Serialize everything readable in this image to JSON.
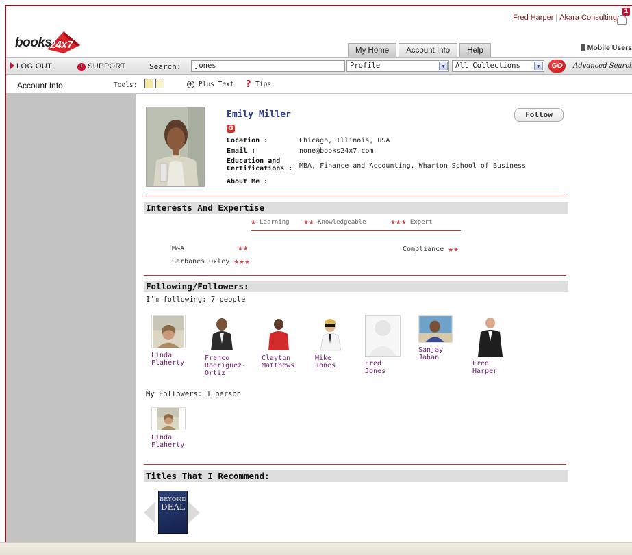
{
  "header": {
    "user_name": "Fred Harper",
    "organization": "Akara Consulting",
    "separator": "|",
    "notification_count": "1",
    "logo_text": "books",
    "logo_badge": "24x7",
    "mobile_users": "Mobile Users"
  },
  "nav_tabs": [
    {
      "label": "My Home"
    },
    {
      "label": "Account Info"
    },
    {
      "label": "Help"
    }
  ],
  "toolbar": {
    "logout": "LOG OUT",
    "support": "SUPPORT",
    "search_label": "Search:",
    "search_value": "jones",
    "search_type": "Profile",
    "collection": "All Collections",
    "go": "GO",
    "advanced_search": "Advanced Search"
  },
  "section_bar": {
    "title": "Account Info",
    "tools_label": "Tools:",
    "plus_text": "Plus Text",
    "tips": "Tips"
  },
  "profile": {
    "name": "Emily Miller",
    "follow_label": "Follow",
    "fields": [
      {
        "label": "Location :",
        "value": "Chicago, Illinois, USA"
      },
      {
        "label": "Email :",
        "value": "none@books24x7.com"
      },
      {
        "label": "Education and Certifications :",
        "value": "MBA, Finance and Accounting, Wharton School of Business"
      },
      {
        "label": "About Me :",
        "value": ""
      }
    ]
  },
  "interests": {
    "heading": "Interests And Expertise",
    "legend": [
      {
        "label": "Learning",
        "stars": 1
      },
      {
        "label": "Knowledgeable",
        "stars": 2
      },
      {
        "label": "Expert",
        "stars": 3
      }
    ],
    "skills": [
      {
        "name": "M&A",
        "stars": 2
      },
      {
        "name": "Sarbanes Oxley",
        "stars": 3
      },
      {
        "name": "Compliance",
        "stars": 2
      }
    ]
  },
  "following": {
    "heading": "Following/Followers:",
    "following_label": "I'm following:",
    "following_count": "7 people",
    "people": [
      {
        "name": "Linda Flaherty",
        "line1": "Linda",
        "line2": "Flaherty",
        "line3": ""
      },
      {
        "name": "Franco Rodriguez-Ortiz",
        "line1": "Franco",
        "line2": "Rodriguez-",
        "line3": "Ortiz"
      },
      {
        "name": "Clayton Matthews",
        "line1": "Clayton",
        "line2": "Matthews",
        "line3": ""
      },
      {
        "name": "Mike Jones",
        "line1": "Mike",
        "line2": "Jones",
        "line3": ""
      },
      {
        "name": "Fred Jones",
        "line1": "Fred",
        "line2": "Jones",
        "line3": ""
      },
      {
        "name": "Sanjay Jahan",
        "line1": "Sanjay",
        "line2": "Jahan",
        "line3": ""
      },
      {
        "name": "Fred Harper",
        "line1": "Fred",
        "line2": "Harper",
        "line3": ""
      }
    ],
    "followers_label": "My Followers:",
    "followers_count": "1 person",
    "followers": [
      {
        "name": "Linda Flaherty",
        "line1": "Linda",
        "line2": "Flaherty"
      }
    ]
  },
  "titles": {
    "heading": "Titles That I Recommend:",
    "book_line1": "BEYOND",
    "book_line2": "DEAL"
  },
  "colors": {
    "brand_red": "#c8102e",
    "star": "#c8434d",
    "name_purple": "#6b1d6b",
    "profile_blue": "#2a3a8c"
  }
}
